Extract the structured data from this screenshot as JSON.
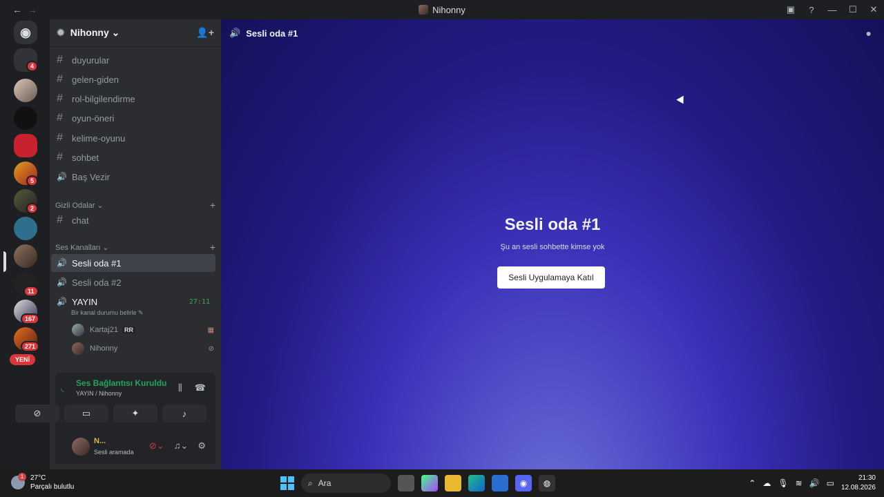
{
  "window": {
    "title": "Nihonny",
    "back": "←",
    "forward": "→"
  },
  "rail": {
    "home_icon": "discord-logo",
    "badges": [
      "4",
      "5",
      "2",
      "11",
      "167",
      "271"
    ],
    "new_label": "YENİ"
  },
  "server": {
    "name": "Nihonny ⌄"
  },
  "channels": [
    {
      "icon": "#",
      "label": "duyurular"
    },
    {
      "icon": "#",
      "label": "gelen-giden"
    },
    {
      "icon": "#",
      "label": "rol-bilgilendirme"
    },
    {
      "icon": "#",
      "label": "oyun-öneri"
    },
    {
      "icon": "#",
      "label": "kelime-oyunu"
    },
    {
      "icon": "#",
      "label": "sohbet"
    },
    {
      "icon": "🔊",
      "label": "Baş Vezir"
    }
  ],
  "categories": {
    "hidden": "Gizli Odalar ⌄",
    "voice": "Ses Kanalları ⌄"
  },
  "hidden_channels": [
    {
      "icon": "#",
      "label": "chat"
    }
  ],
  "voice_channels": [
    {
      "label": "Sesli oda #1"
    },
    {
      "label": "Sesli oda #2"
    },
    {
      "label": "YAYIN",
      "timer": "27:11"
    }
  ],
  "yayin_status": "Bir kanal durumu belirle ✎",
  "voice_users": [
    {
      "name": "Kartaj21",
      "tag": "RR"
    },
    {
      "name": "Nihonny"
    }
  ],
  "voice_panel": {
    "title": "Ses Bağlantısı Kuruldu",
    "subtitle": "YAYIN / Nihonny"
  },
  "user_panel": {
    "name": "N...",
    "status": "Sesli aramada"
  },
  "main": {
    "header": "Sesli oda #1",
    "title": "Sesli oda #1",
    "subtitle": "Şu an sesli sohbette kimse yok",
    "join_button": "Sesli Uygulamaya Katıl"
  },
  "taskbar": {
    "temperature": "27°C",
    "weather": "Parçalı bulutlu",
    "weather_badge": "1",
    "search": "Ara",
    "time": "21:30",
    "date": "12.08.2026"
  }
}
